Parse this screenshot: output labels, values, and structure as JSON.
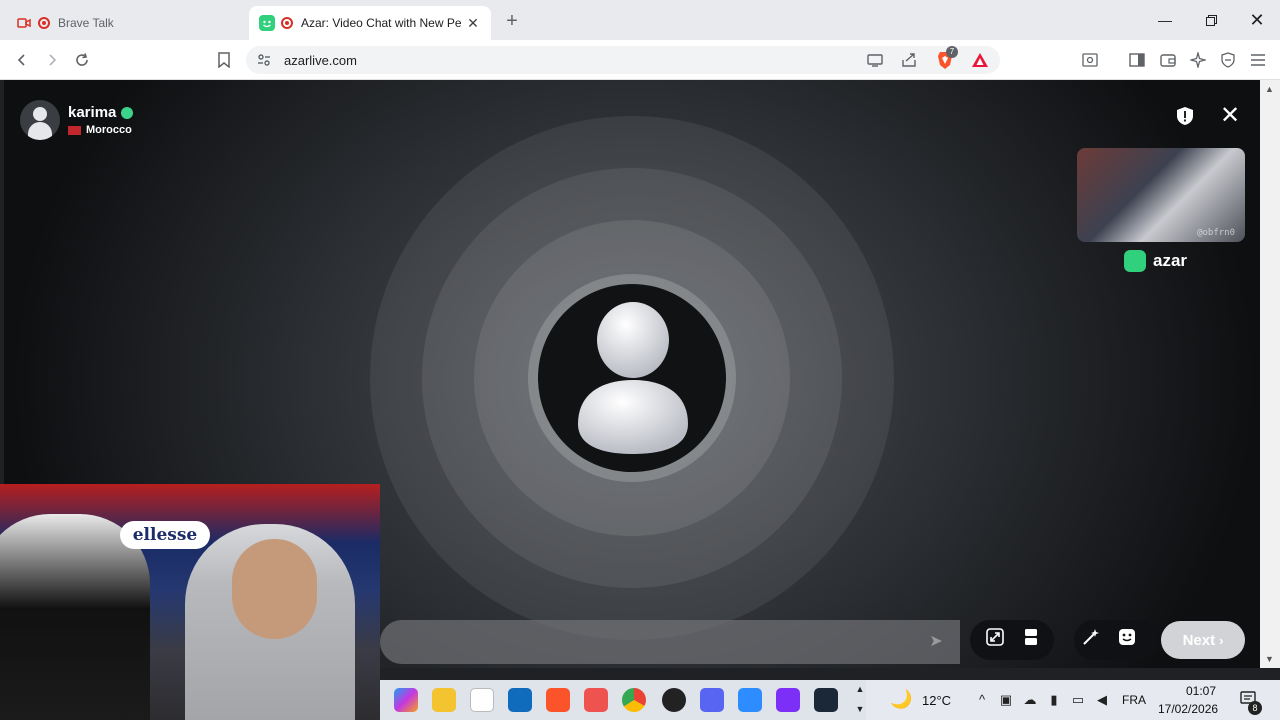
{
  "tabs": [
    {
      "title": "Brave Talk",
      "active": false
    },
    {
      "title": "Azar: Video Chat with New Pe",
      "active": true
    }
  ],
  "toolbar": {
    "url": "azarlive.com",
    "brave_shield_count": "7"
  },
  "chat": {
    "username": "karima",
    "country": "Morocco",
    "brand": "azar",
    "selfcam_caption": "@obfrn0",
    "next_label": "Next"
  },
  "webcam": {
    "logo_text": "ellesse"
  },
  "taskbar": {
    "weather": "12°C",
    "language": "FRA",
    "time": "01:07",
    "date": "17/02/2026",
    "notifications": "8"
  },
  "colors": {
    "azar_green": "#30d07c",
    "verified_green": "#3cd48a",
    "morocco_red": "#c1272d",
    "brave_orange": "#fb542b",
    "next_button": "#d1d3d6"
  }
}
